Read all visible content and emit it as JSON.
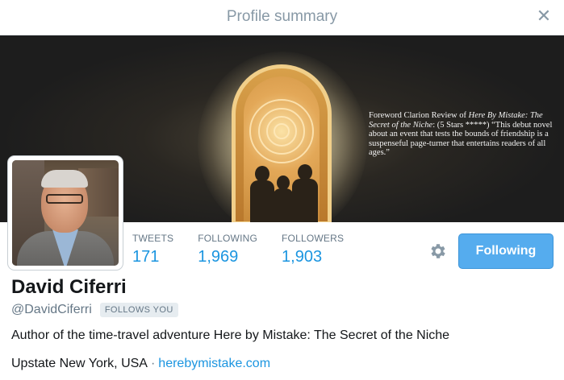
{
  "header": {
    "title": "Profile summary",
    "close_icon": "close-icon"
  },
  "banner": {
    "quote_parts": {
      "prefix": "Foreword Clarion Review of ",
      "book_title_line1": "Here By Mistake:",
      "book_title_line2": "The Secret of the Niche",
      "rest": ": (5 Stars *****) “This debut novel about an event that tests the bounds of friendship is a suspenseful page-turner that entertains readers of all ages.”"
    }
  },
  "profile": {
    "name": "David Ciferri",
    "handle": "@DavidCiferri",
    "follows_you": "FOLLOWS YOU",
    "bio": "Author of the time-travel adventure Here by Mistake: The Secret of the Niche",
    "location": "Upstate New York, USA",
    "separator": "·",
    "website": "herebymistake.com"
  },
  "stats": [
    {
      "label": "TWEETS",
      "value": "171"
    },
    {
      "label": "FOLLOWING",
      "value": "1,969"
    },
    {
      "label": "FOLLOWERS",
      "value": "1,903"
    }
  ],
  "actions": {
    "following_label": "Following",
    "settings_icon": "gear-icon"
  },
  "colors": {
    "accent": "#1b95e0",
    "button": "#55acee",
    "muted": "#657786"
  }
}
